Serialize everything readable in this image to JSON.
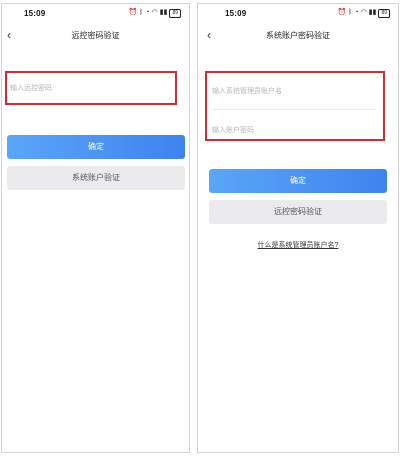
{
  "left_screen": {
    "status": {
      "time": "15:09",
      "battery": "89"
    },
    "title": "远控密码验证",
    "password_placeholder": "输入远控密码",
    "confirm_button": "确定",
    "switch_button": "系统账户验证"
  },
  "right_screen": {
    "status": {
      "time": "15:09",
      "battery": "89"
    },
    "title": "系统账户密码验证",
    "account_placeholder": "输入系统管理员账户名",
    "password_placeholder": "输入账户密码",
    "confirm_button": "确定",
    "switch_button": "远控密码验证",
    "help_link": "什么是系统管理员账户名?"
  },
  "colors": {
    "primary_button": "#3d83ef",
    "highlight_border": "#d9282f",
    "secondary_button": "#ebebee"
  },
  "icons": [
    "back-chevron-icon",
    "alarm-icon",
    "bluetooth-icon",
    "wifi-icon",
    "signal-icon",
    "battery-icon"
  ]
}
